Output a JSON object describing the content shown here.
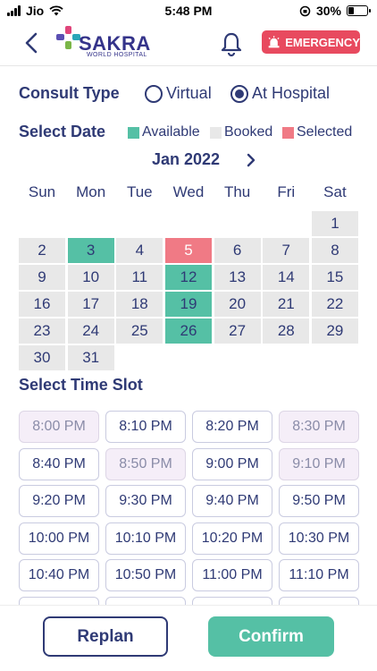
{
  "status_bar": {
    "carrier": "Jio",
    "time": "5:48 PM",
    "battery": "30%",
    "battery_level": 0.3
  },
  "header": {
    "emergency_label": "EMERGENCY",
    "logo": {
      "name": "SAKRA",
      "subtitle": "WORLD HOSPITAL"
    }
  },
  "consult": {
    "title": "Consult Type",
    "options": [
      "Virtual",
      "At Hospital"
    ],
    "selected": "At Hospital"
  },
  "date": {
    "title": "Select Date",
    "legend": {
      "available": "Available",
      "booked": "Booked",
      "selected": "Selected"
    },
    "month": "Jan 2022",
    "weekdays": [
      "Sun",
      "Mon",
      "Tue",
      "Wed",
      "Thu",
      "Fri",
      "Sat"
    ],
    "days": [
      "1",
      "2",
      "3",
      "4",
      "5",
      "6",
      "7",
      "8",
      "9",
      "10",
      "11",
      "12",
      "13",
      "14",
      "15",
      "16",
      "17",
      "18",
      "19",
      "20",
      "21",
      "22",
      "23",
      "24",
      "25",
      "26",
      "27",
      "28",
      "29",
      "30",
      "31"
    ],
    "available_days": [
      "3",
      "12",
      "19",
      "26"
    ],
    "selected_day": "5"
  },
  "time": {
    "title": "Select Time Slot",
    "slots": [
      "8:00 PM",
      "8:10 PM",
      "8:20 PM",
      "8:30 PM",
      "8:40 PM",
      "8:50 PM",
      "9:00 PM",
      "9:10 PM",
      "9:20 PM",
      "9:30 PM",
      "9:40 PM",
      "9:50 PM",
      "10:00 PM",
      "10:10 PM",
      "10:20 PM",
      "10:30 PM",
      "10:40 PM",
      "10:50 PM",
      "11:00 PM",
      "11:10 PM",
      "",
      "",
      "",
      ""
    ],
    "booked_slots": [
      "8:00 PM",
      "8:30 PM",
      "8:50 PM",
      "9:10 PM"
    ]
  },
  "footer": {
    "replan_label": "Replan",
    "confirm_label": "Confirm"
  },
  "colors": {
    "primary": "#2f3a75",
    "available": "#55c0a5",
    "selected": "#f07a85",
    "booked": "#e8e8e8",
    "emergency": "#e84a5f"
  }
}
